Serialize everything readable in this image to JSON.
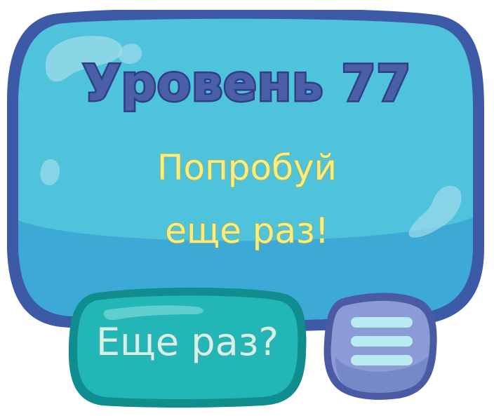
{
  "level_title": "Уровень 77",
  "message": {
    "line1": "Попробуй",
    "line2": "еще раз!"
  },
  "retry_button": {
    "label": "Еще раз?"
  },
  "menu_button": {
    "icon": "hamburger-menu-icon"
  },
  "colors": {
    "panel_fill": "#4fc3dc",
    "panel_border": "#3d5aa6",
    "title_text": "#4a5fa8",
    "message_text": "#f4ee86",
    "retry_fill": "#23b6b7",
    "retry_border": "#0f8d8f",
    "menu_fill": "#8a9bd6",
    "menu_border": "#4a5aa3"
  }
}
